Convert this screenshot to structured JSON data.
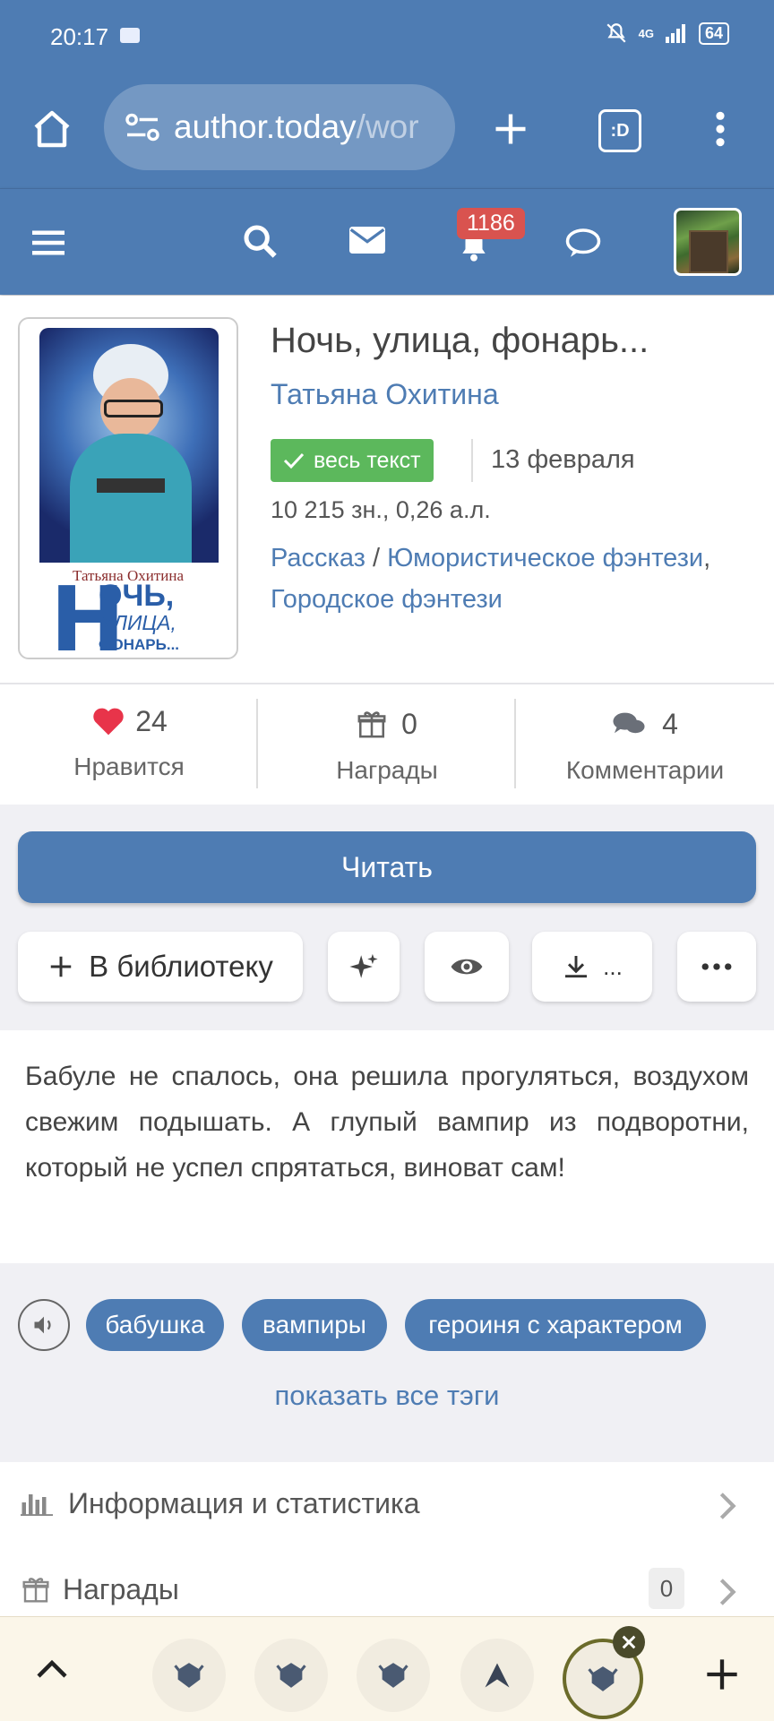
{
  "status_bar": {
    "time": "20:17",
    "network": "4G",
    "battery": "64"
  },
  "browser": {
    "url_host": "author.today",
    "url_path": "/wor",
    "tab_count": ":D"
  },
  "nav": {
    "notifications_count": "1186"
  },
  "book": {
    "cover": {
      "author": "Татьяна Охитина",
      "big_letter": "Н",
      "line1": "ОЧЬ,",
      "line2": "УЛИЦА,",
      "line3": "ФОНАРЬ..."
    },
    "title": "Ночь, улица, фонарь...",
    "author": "Татьяна Охитина",
    "status": "весь текст",
    "date": "13 февраля",
    "size": "10 215 зн., 0,26 а.л.",
    "form": "Рассказ",
    "separator": " / ",
    "genre1": "Юмористическое фэнтези",
    "comma": ",",
    "genre2": "Городское фэнтези"
  },
  "stats": {
    "likes": {
      "value": "24",
      "label": "Нравится"
    },
    "awards": {
      "value": "0",
      "label": "Награды"
    },
    "comments": {
      "value": "4",
      "label": "Комментарии"
    }
  },
  "actions": {
    "read_label": "Читать",
    "library_label": "В библиотеку",
    "download_label": "..."
  },
  "annotation": "Бабуле не спалось, она решила прогуляться, воздухом свежим подышать. А глупый вампир из подворотни, который не успел спрятаться, виноват сам!",
  "tags": {
    "items": [
      "бабушка",
      "вампиры",
      "героиня с характером"
    ],
    "show_all": "показать все тэги"
  },
  "info_rows": [
    {
      "label": "Информация и статистика"
    },
    {
      "label": "Награды",
      "count": "0"
    }
  ],
  "colors": {
    "brand_blue": "#4e7cb3",
    "green": "#5cb85c",
    "badge_red": "#d9534f",
    "heart": "#e8344a"
  }
}
